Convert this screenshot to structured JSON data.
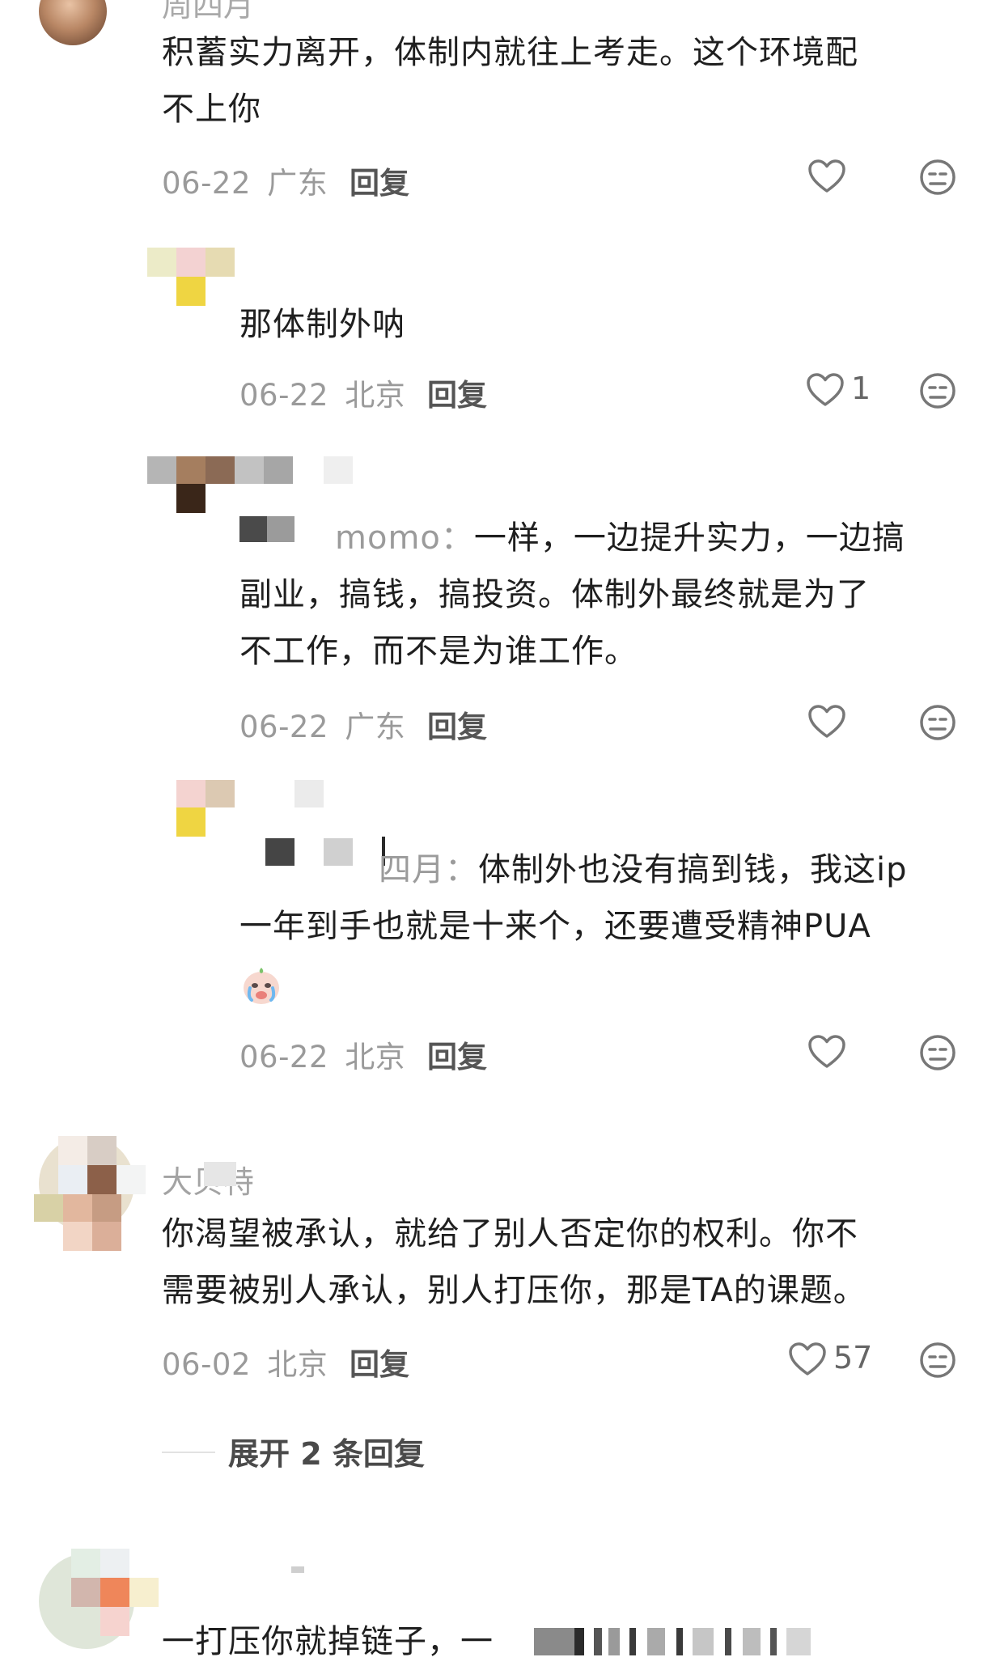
{
  "comments": [
    {
      "author": "周四月",
      "text_line1": "积蓄实力离开，体制内就往上考走。这个环境配",
      "text_line2": "不上你",
      "date": "06-22",
      "region": "广东",
      "reply_label": "回复"
    },
    {
      "text": "那体制外呐",
      "date": "06-22",
      "region": "北京",
      "reply_label": "回复",
      "like_count": "1"
    },
    {
      "reply_to": "momo：",
      "text_line1": "一样，一边提升实力，一边搞",
      "text_line2": "副业，搞钱，搞投资。体制外最终就是为了",
      "text_line3": "不工作，而不是为谁工作。",
      "date": "06-22",
      "region": "广东",
      "reply_label": "回复"
    },
    {
      "reply_to": "四月：",
      "text_line1": "体制外也没有搞到钱，我这ip",
      "text_line2": "一年到手也就是十来个，还要遭受精神PUA",
      "date": "06-22",
      "region": "北京",
      "reply_label": "回复"
    },
    {
      "author": "大贝特",
      "text_line1": "你渴望被承认，就给了别人否定你的权利。你不",
      "text_line2": "需要被别人承认，别人打压你，那是TA的课题。",
      "date": "06-02",
      "region": "北京",
      "reply_label": "回复",
      "like_count": "57",
      "expand_label": "展开 2 条回复"
    },
    {
      "text": "一打压你就掉链子，一"
    }
  ],
  "icons": {
    "like": "heart-outline-icon",
    "dislike": "meh-face-icon"
  },
  "colors": {
    "meta_gray": "#9a9a9a",
    "text": "#1f1f1f",
    "reply_gray": "#555555"
  }
}
